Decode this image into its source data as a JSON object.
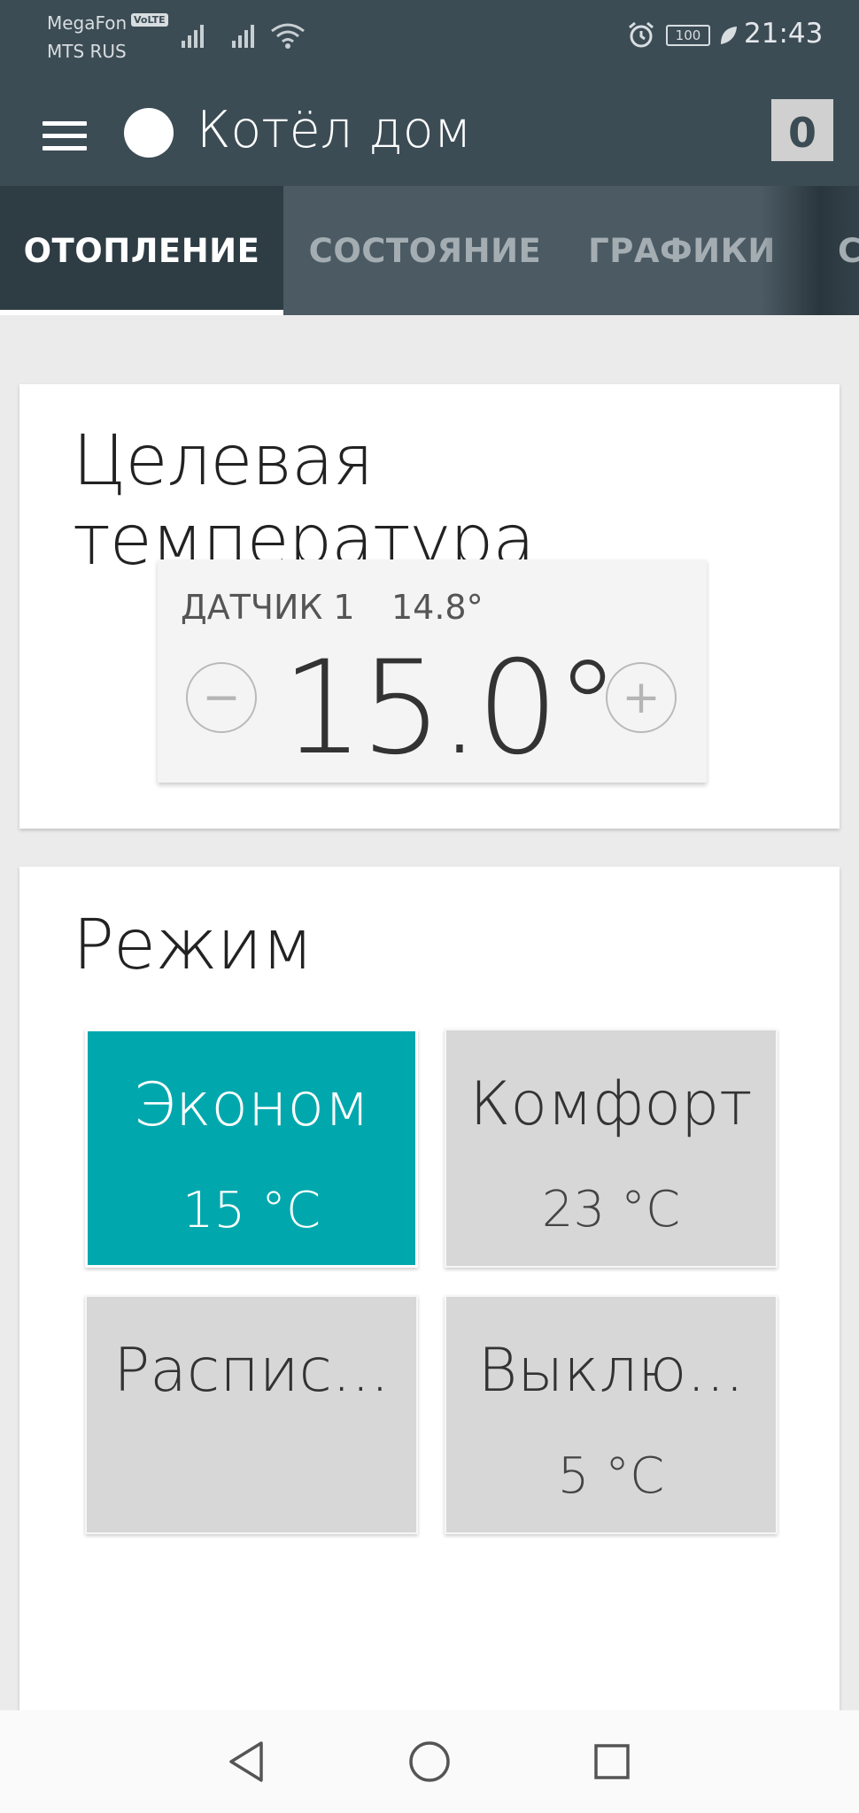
{
  "status_bar": {
    "carrier1": "MegaFon",
    "volte": "VoLTE",
    "carrier2": "MTS RUS",
    "battery": "100",
    "time": "21:43"
  },
  "app_bar": {
    "title": "Котёл дом",
    "badge": "0"
  },
  "tabs": [
    {
      "label": "ОТОПЛЕНИЕ",
      "active": true
    },
    {
      "label": "СОСТОЯНИЕ"
    },
    {
      "label": "ГРАФИКИ"
    },
    {
      "label": "С"
    }
  ],
  "target_card": {
    "title": "Целевая температура",
    "sensor_label": "ДАТЧИК 1",
    "sensor_value": "14.8°",
    "target_value": "15.0°",
    "minus_label": "−",
    "plus_label": "+"
  },
  "mode_card": {
    "title": "Режим",
    "modes": [
      {
        "name": "Эконом",
        "temp": "15 °C",
        "active": true
      },
      {
        "name": "Комфорт",
        "temp": "23 °C"
      },
      {
        "name": "Распис...",
        "temp": ""
      },
      {
        "name": "Выклю...",
        "temp": "5 °C"
      }
    ]
  },
  "colors": {
    "header": "#3c4c55",
    "active_mode": "#00a8ad",
    "inactive_mode": "#d7d7d7"
  },
  "icons": {
    "menu": "hamburger-menu-icon",
    "status": "status-dot-icon",
    "signal": "signal-icon",
    "wifi": "wifi-icon",
    "alarm": "alarm-icon",
    "battery": "battery-icon",
    "leaf": "power-saving-leaf-icon",
    "back": "back-triangle-icon",
    "home": "home-circle-icon",
    "recents": "recents-square-icon"
  }
}
